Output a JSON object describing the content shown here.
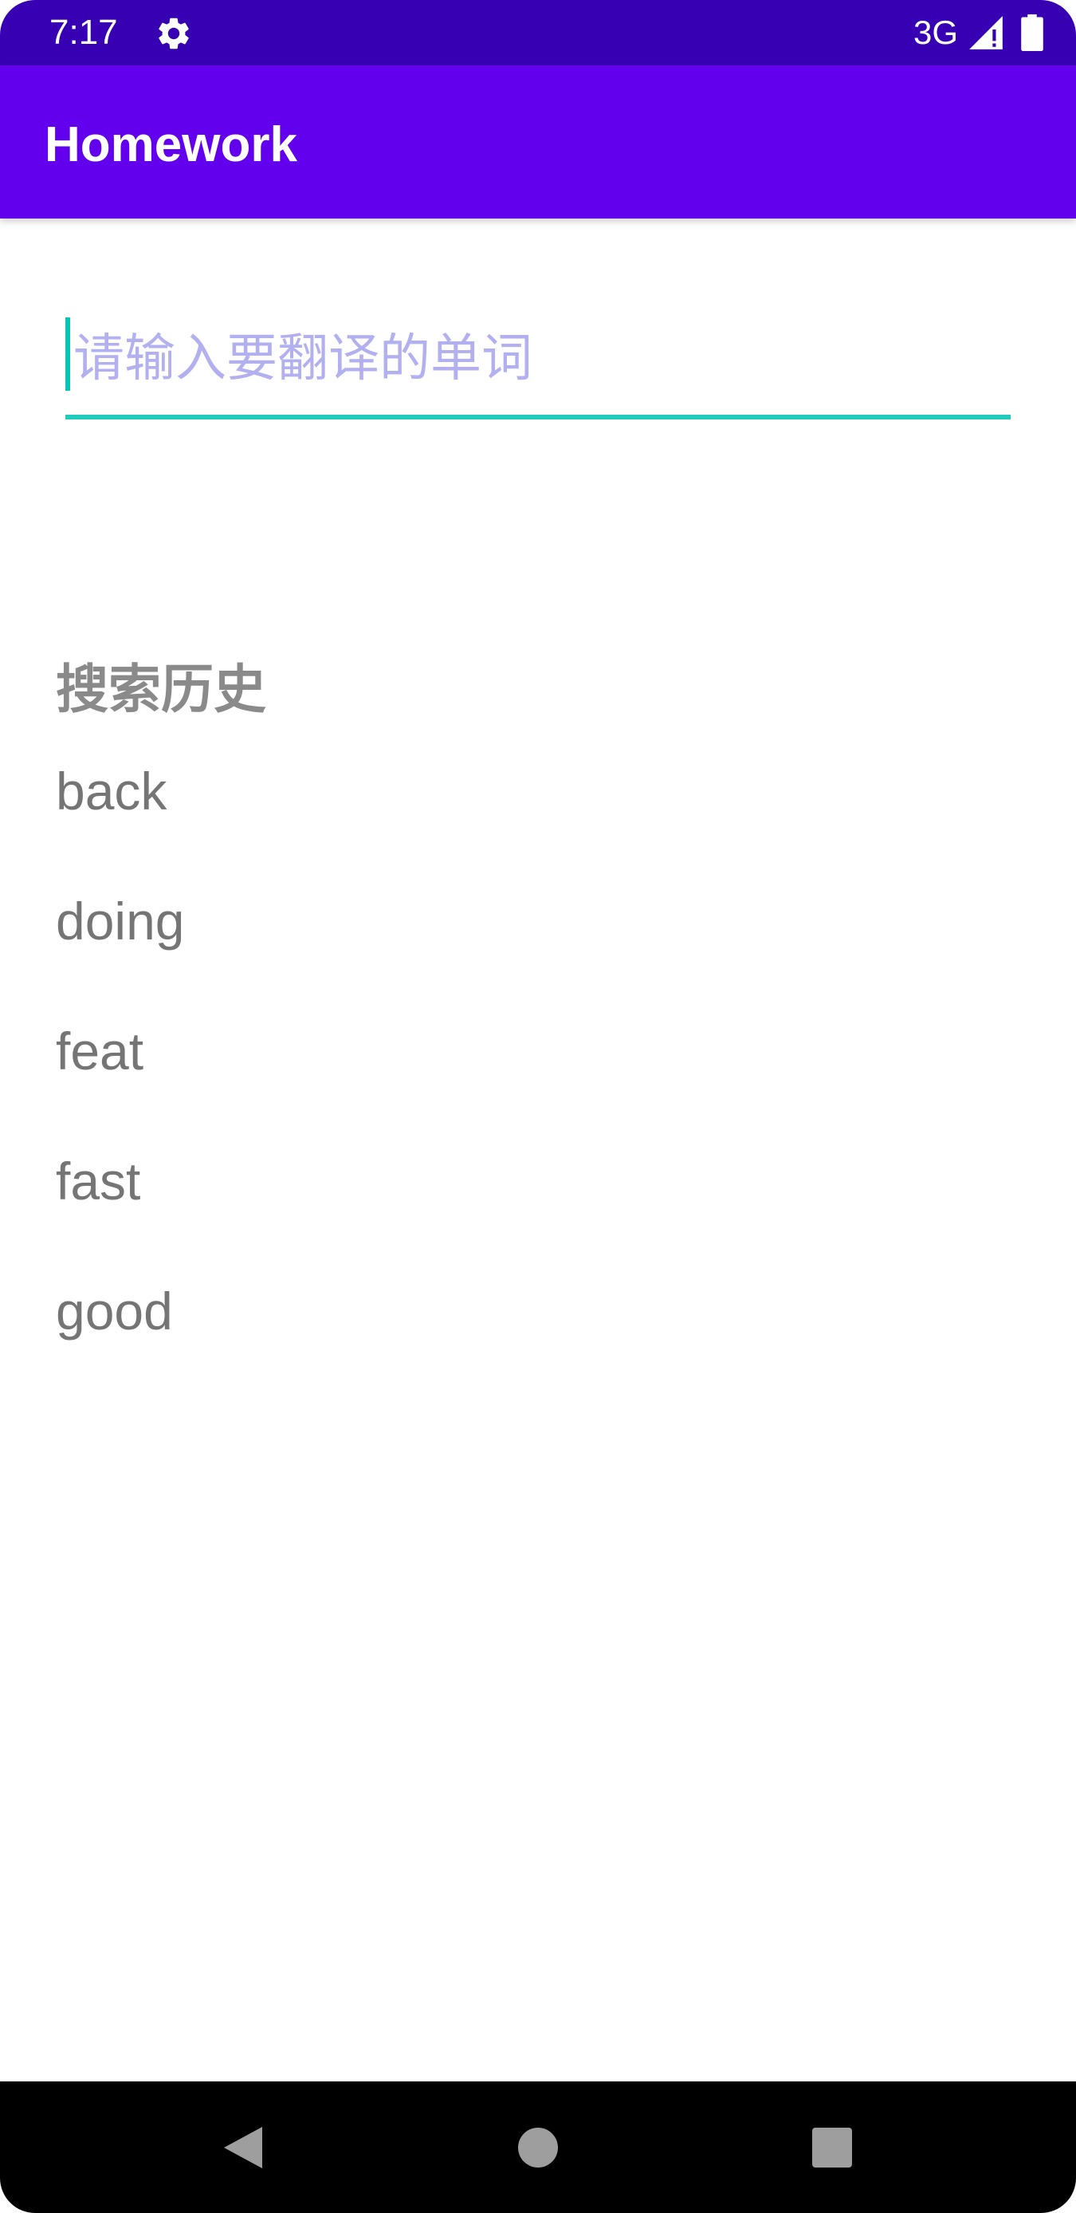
{
  "status_bar": {
    "time": "7:17",
    "network": "3G",
    "icons": [
      "gear-icon",
      "signal-icon",
      "battery-icon"
    ]
  },
  "app_bar": {
    "title": "Homework"
  },
  "search": {
    "placeholder": "请输入要翻译的单词",
    "value": ""
  },
  "history": {
    "header": "搜索历史",
    "items": [
      "back",
      "doing",
      "feat",
      "fast",
      "good"
    ]
  },
  "nav_bar": {
    "icons": [
      "back-icon",
      "home-icon",
      "recents-icon"
    ]
  },
  "colors": {
    "status_bar": "#3700b3",
    "app_bar": "#6200ee",
    "accent": "#03dac5",
    "placeholder": "#b3b0f0",
    "history_text": "#757575"
  }
}
